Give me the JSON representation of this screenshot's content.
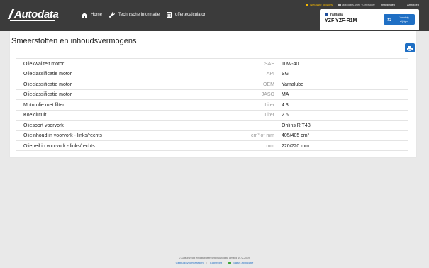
{
  "header": {
    "logo_text": "Autodata",
    "nav": [
      {
        "label": "Home",
        "icon": "home-icon"
      },
      {
        "label": "Technische informatie",
        "icon": "wrench-icon"
      },
      {
        "label": "offertecalculator",
        "icon": "calculator-icon"
      }
    ],
    "topbar": {
      "updates": "Nieuwste updates",
      "user": "autodata-user · Gebruiker",
      "settings": "Instellingen",
      "logout": "Afmelden"
    },
    "vehicle": {
      "make": "Yamaha",
      "model": "YZF YZF-R1M",
      "swap_label_line1": "Voertuig",
      "swap_label_line2": "wijzigen"
    }
  },
  "page": {
    "title": "Smeerstoffen en inhoudsvermogens"
  },
  "table": {
    "rows": [
      {
        "label": "Oliekwaliteit motor",
        "unit": "SAE",
        "value": "10W-40"
      },
      {
        "label": "Olieclassificatie motor",
        "unit": "API",
        "value": "SG"
      },
      {
        "label": "Olieclassificatie motor",
        "unit": "OEM",
        "value": "Yamalube"
      },
      {
        "label": "Olieclassificatie motor",
        "unit": "JASO",
        "value": "MA"
      },
      {
        "label": "Motorolie met filter",
        "unit": "Liter",
        "value": "4.3"
      },
      {
        "label": "Koelcircuit",
        "unit": "Liter",
        "value": "2.6"
      },
      {
        "label": "Oliesoort voorvork",
        "unit": "",
        "value": "Ohlins R T43"
      },
      {
        "label": "Olieinhoud in voorvork - links/rechts",
        "unit": "cm³ of mm",
        "value": "405/405 cm³"
      },
      {
        "label": "Oliepeil in voorvork - links/rechts",
        "unit": "mm",
        "value": "220/220 mm"
      }
    ]
  },
  "footer": {
    "copyright": "© Auteursrecht en databaserechten Autodata Limited 1972-2019.",
    "links": {
      "privacy": "Gebruiksvoorwaarden",
      "copyright": "Copyright",
      "status": "Status applicatie"
    }
  },
  "colors": {
    "header_bg": "#3b3b3b",
    "accent_blue": "#1f6fc4",
    "updates_yellow": "#f5b800",
    "status_green": "#3aa335"
  }
}
